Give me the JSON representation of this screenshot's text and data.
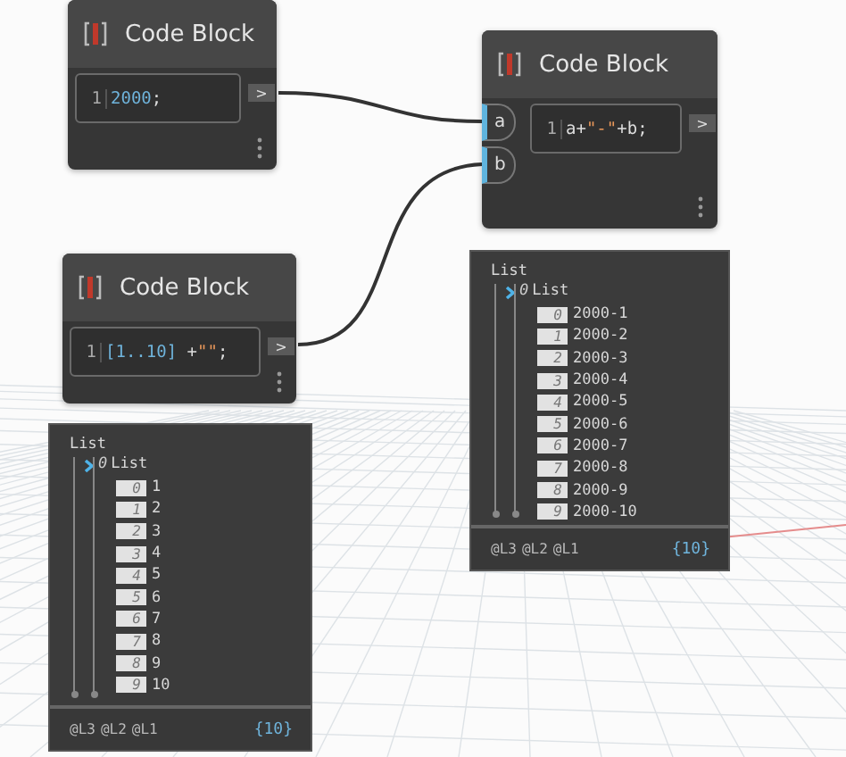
{
  "nodes": [
    {
      "title": "Code Block",
      "line_number": "1",
      "code": [
        {
          "text": "2000",
          "kind": "number"
        },
        {
          "text": ";",
          "kind": "plain"
        }
      ],
      "output": ">"
    },
    {
      "title": "Code Block",
      "line_number": "1",
      "code": [
        {
          "text": "a+",
          "kind": "plain"
        },
        {
          "text": "\"-\"",
          "kind": "string"
        },
        {
          "text": "+b;",
          "kind": "plain"
        }
      ],
      "inputs": [
        {
          "label": "a"
        },
        {
          "label": "b"
        }
      ],
      "output": ">"
    },
    {
      "title": "Code Block",
      "line_number": "1",
      "code": [
        {
          "text": "[1..10]",
          "kind": "number"
        },
        {
          "text": " +",
          "kind": "plain"
        },
        {
          "text": "\"\"",
          "kind": "string"
        },
        {
          "text": ";",
          "kind": "plain"
        }
      ],
      "output": ">"
    }
  ],
  "previews": [
    {
      "root": "List",
      "list_index": "0",
      "list_label": "List",
      "items": [
        {
          "index": "0",
          "value": "2000-1"
        },
        {
          "index": "1",
          "value": "2000-2"
        },
        {
          "index": "2",
          "value": "2000-3"
        },
        {
          "index": "3",
          "value": "2000-4"
        },
        {
          "index": "4",
          "value": "2000-5"
        },
        {
          "index": "5",
          "value": "2000-6"
        },
        {
          "index": "6",
          "value": "2000-7"
        },
        {
          "index": "7",
          "value": "2000-8"
        },
        {
          "index": "8",
          "value": "2000-9"
        },
        {
          "index": "9",
          "value": "2000-10"
        }
      ],
      "levels": [
        "@L3",
        "@L2",
        "@L1"
      ],
      "count": "{10}"
    },
    {
      "root": "List",
      "list_index": "0",
      "list_label": "List",
      "items": [
        {
          "index": "0",
          "value": "1"
        },
        {
          "index": "1",
          "value": "2"
        },
        {
          "index": "2",
          "value": "3"
        },
        {
          "index": "3",
          "value": "4"
        },
        {
          "index": "4",
          "value": "5"
        },
        {
          "index": "5",
          "value": "6"
        },
        {
          "index": "6",
          "value": "7"
        },
        {
          "index": "7",
          "value": "8"
        },
        {
          "index": "8",
          "value": "9"
        },
        {
          "index": "9",
          "value": "10"
        }
      ],
      "levels": [
        "@L3",
        "@L2",
        "@L1"
      ],
      "count": "{10}"
    }
  ]
}
